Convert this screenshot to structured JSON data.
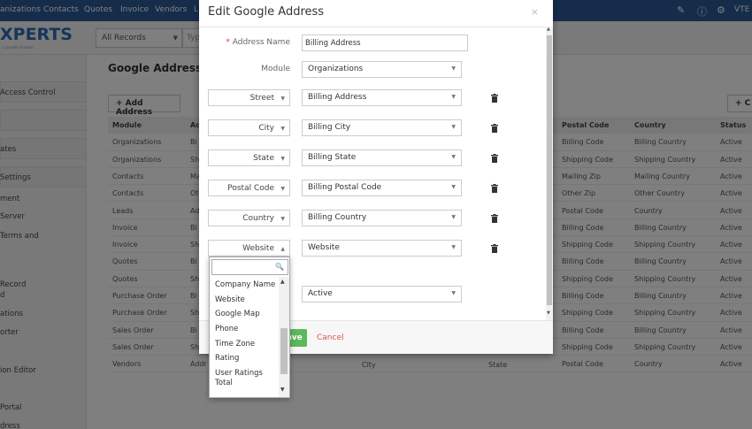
{
  "topnav": {
    "items": [
      "anizations",
      "Contacts",
      "Quotes",
      "Invoice",
      "Vendors",
      "L"
    ],
    "right_text": "VTE",
    "icons": [
      "pencil-icon",
      "info-icon",
      "gear-icon"
    ],
    "background": "#2a5a96"
  },
  "header": {
    "logo_text": "XPERTS",
    "logo_sub": "a Lourdes Product",
    "records_select": "All Records",
    "search_placeholder": "Typ"
  },
  "sidebar": {
    "items": [
      "Access Control",
      "ates",
      "Settings",
      "ment",
      "Server",
      "Terms and",
      "Record",
      "d",
      "ations",
      "orter",
      "ion Editor",
      "Portal",
      "dress"
    ]
  },
  "main": {
    "title": "Google Address",
    "add_button": "+ Add Address",
    "right_button": "+ C",
    "table": {
      "headers": [
        "Module",
        "Ad",
        "Postal Code",
        "Country",
        "Status"
      ],
      "rows": [
        [
          "Organizations",
          "Bi",
          "Billing Code",
          "Billing Country",
          "Active"
        ],
        [
          "Organizations",
          "Sh",
          "Shipping Code",
          "Shipping Country",
          "Active"
        ],
        [
          "Contacts",
          "Ma",
          "Mailing Zip",
          "Mailing Country",
          "Active"
        ],
        [
          "Contacts",
          "Ot",
          "Other Zip",
          "Other Country",
          "Active"
        ],
        [
          "Leads",
          "Ad",
          "Postal Code",
          "Country",
          "Active"
        ],
        [
          "Invoice",
          "Bi",
          "Billing Code",
          "Billing Country",
          "Active"
        ],
        [
          "Invoice",
          "Sh",
          "Shipping Code",
          "Shipping Country",
          "Active"
        ],
        [
          "Quotes",
          "Bi",
          "Billing Code",
          "Billing Country",
          "Active"
        ],
        [
          "Quotes",
          "Sh",
          "Shipping Code",
          "Shipping Country",
          "Active"
        ],
        [
          "Purchase Order",
          "Bi",
          "Billing Code",
          "Billing Country",
          "Active"
        ],
        [
          "Purchase Order",
          "Sh",
          "Shipping Code",
          "Shipping Country",
          "Active"
        ],
        [
          "Sales Order",
          "Bi",
          "Billing Code",
          "Billing Country",
          "Active"
        ],
        [
          "Sales Order",
          "Sh",
          "Shipping Code",
          "Shipping Country",
          "Active"
        ],
        [
          "Vendors",
          "Addr",
          "Postal Code",
          "Country",
          "Active"
        ]
      ],
      "vendors_extra": [
        "et",
        "City",
        "State"
      ]
    }
  },
  "modal": {
    "title": "Edit Google Address",
    "close": "×",
    "address_name_label": "Address Name",
    "required_mark": "*",
    "address_name_value": "Billing Address",
    "module_label": "Module",
    "module_value": "Organizations",
    "mappings": [
      {
        "field": "Street",
        "value": "Billing Address"
      },
      {
        "field": "City",
        "value": "Billing City"
      },
      {
        "field": "State",
        "value": "Billing State"
      },
      {
        "field": "Postal Code",
        "value": "Billing Postal Code"
      },
      {
        "field": "Country",
        "value": "Billing Country"
      },
      {
        "field": "Website",
        "value": "Website"
      }
    ],
    "status_value": "Active",
    "save_label": "Save",
    "cancel_label": "Cancel"
  },
  "dropdown": {
    "options": [
      "Company Name",
      "Website",
      "Google Map",
      "Phone",
      "Time Zone",
      "Rating",
      "User Ratings",
      "Total"
    ]
  },
  "colors": {
    "save": "#5cb85c",
    "cancel": "#d9534f",
    "required": "#e03a3a"
  }
}
